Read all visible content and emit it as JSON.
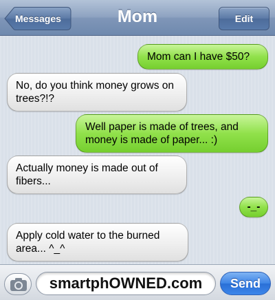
{
  "navbar": {
    "title": "Mom",
    "back_label": "Messages",
    "edit_label": "Edit"
  },
  "messages": [
    {
      "side": "sent",
      "text": "Mom can I have $50?"
    },
    {
      "side": "received",
      "text": "No, do you think money grows on trees?!?"
    },
    {
      "side": "sent",
      "text": "Well paper is made of trees, and money is made of paper... :)"
    },
    {
      "side": "received",
      "text": "Actually money is made out of fibers..."
    },
    {
      "side": "sent",
      "text": "-_-"
    },
    {
      "side": "received",
      "text": "Apply cold water to the burned area... ^_^"
    }
  ],
  "composer": {
    "input_value": "smartphOWNED.com",
    "send_label": "Send",
    "camera_icon": "camera-icon"
  },
  "colors": {
    "sent_bubble": "#8ddc48",
    "received_bubble": "#eeeeee",
    "navbar": "#8ea3c1",
    "send_button": "#3d84e6"
  }
}
